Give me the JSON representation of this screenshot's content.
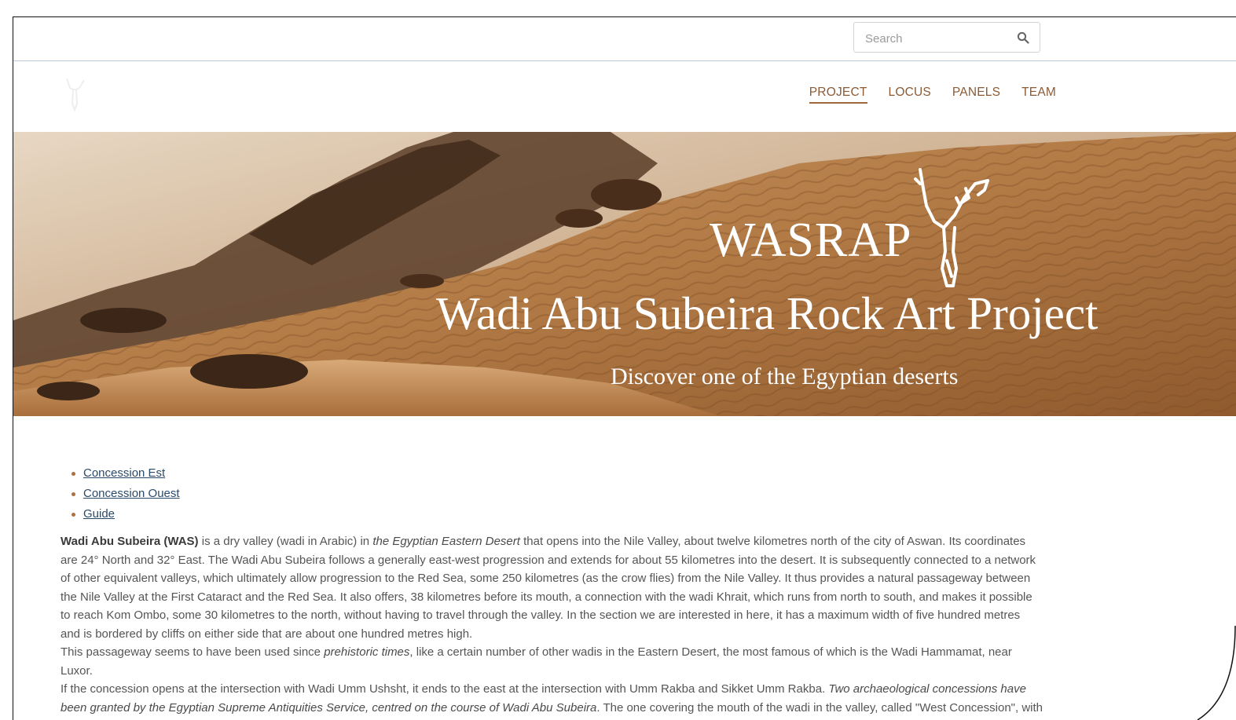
{
  "search": {
    "placeholder": "Search"
  },
  "nav": {
    "items": [
      "PROJECT",
      "LOCUS",
      "PANELS",
      "TEAM"
    ],
    "active": "PROJECT"
  },
  "hero": {
    "brand": "WASRAP",
    "title": "Wadi Abu Subeira Rock Art Project",
    "subtitle": "Discover one of the Egyptian deserts"
  },
  "links": [
    "Concession Est",
    "Concession Ouest",
    "Guide"
  ],
  "content": {
    "p1_bold": "Wadi Abu Subeira (WAS)",
    "p1_a": " is a dry valley (wadi in Arabic) in ",
    "p1_italic": "the Egyptian Eastern Desert",
    "p1_b": " that opens into the Nile Valley, about twelve kilometres north of the city of Aswan. Its coordinates are 24° North and 32° East. The Wadi Abu Subeira follows a generally east-west progression and extends for about 55 kilometres into the desert. It is subsequently connected to a network of other equivalent valleys, which ultimately allow progression to the Red Sea, some 250 kilometres (as the crow flies) from the Nile Valley. It thus provides a natural passageway between the Nile Valley at the First Cataract and the Red Sea. It also offers, 38 kilometres before its mouth, a connection with the wadi Khrait, which runs from north to south, and makes it possible to reach Kom Ombo, some 30 kilometres to the north, without having to travel through the valley. In the section we are interested in here, it has a maximum width of five hundred metres and is bordered by cliffs on either side that are about one hundred metres high.",
    "p2_a": "This passageway seems to have been used since ",
    "p2_italic": "prehistoric times",
    "p2_b": ", like a certain number of other wadis in the Eastern Desert, the most famous of which is the Wadi Hammamat, near Luxor.",
    "p3_a": "If the concession opens at the intersection with Wadi Umm Ushsht, it ends to the east at the intersection with Umm Rakba and Sikket Umm Rakba. ",
    "p3_italic": "Two archaeological concessions have been granted by the Egyptian Supreme Antiquities Service, centred on the course of Wadi Abu Subeira",
    "p3_b": ". The one covering the mouth of the wadi in the valley, called \"West Concession\", with an"
  },
  "colors": {
    "nav_text": "#8b5a34",
    "link": "#2b4a6a",
    "bullet": "#b0703e"
  }
}
